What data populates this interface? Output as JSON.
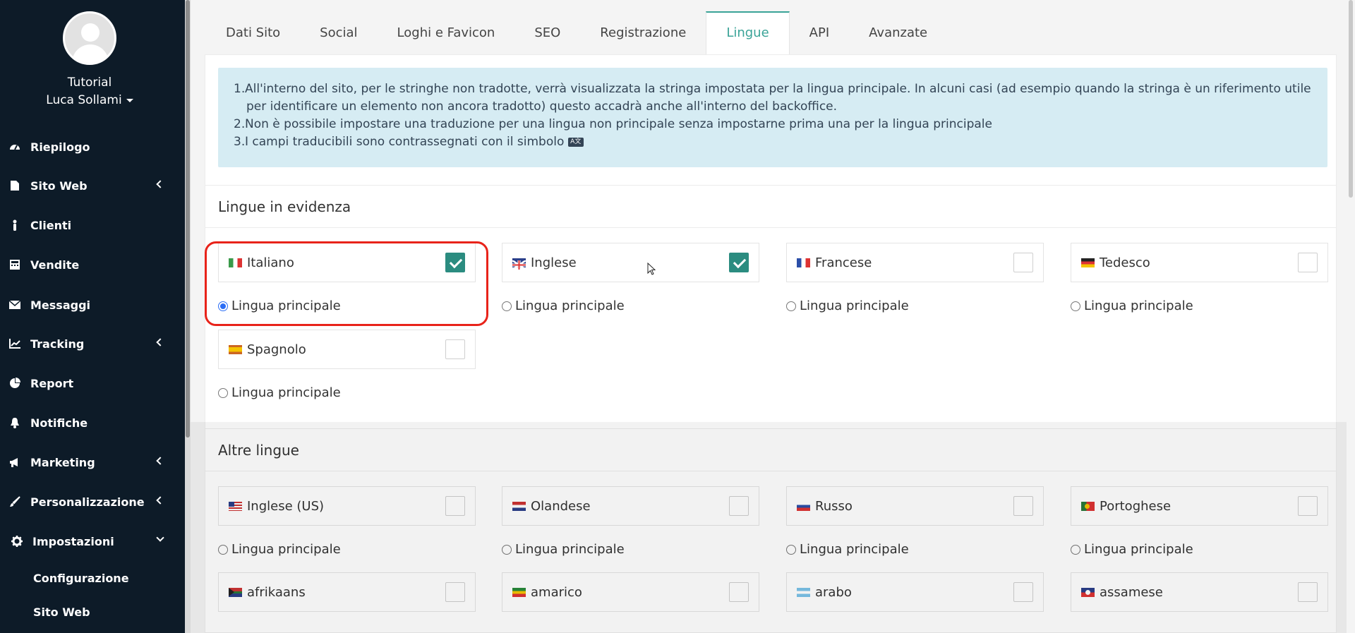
{
  "sidebar": {
    "user_title": "Tutorial",
    "user_name": "Luca Sollami",
    "items": [
      {
        "label": "Riepilogo",
        "icon": "dashboard-icon"
      },
      {
        "label": "Sito Web",
        "icon": "file-icon"
      },
      {
        "label": "Clienti",
        "icon": "person-icon"
      },
      {
        "label": "Vendite",
        "icon": "cash-register-icon"
      },
      {
        "label": "Messaggi",
        "icon": "envelope-icon"
      },
      {
        "label": "Tracking",
        "icon": "chart-line-icon"
      },
      {
        "label": "Report",
        "icon": "pie-chart-icon"
      },
      {
        "label": "Notifiche",
        "icon": "bell-icon"
      },
      {
        "label": "Marketing",
        "icon": "megaphone-icon"
      },
      {
        "label": "Personalizzazione",
        "icon": "brush-icon"
      },
      {
        "label": "Impostazioni",
        "icon": "gear-icon"
      }
    ],
    "subitems": [
      {
        "label": "Configurazione"
      },
      {
        "label": "Sito Web"
      }
    ]
  },
  "tabs": [
    {
      "label": "Dati Sito"
    },
    {
      "label": "Social"
    },
    {
      "label": "Loghi e Favicon"
    },
    {
      "label": "SEO"
    },
    {
      "label": "Registrazione"
    },
    {
      "label": "Lingue",
      "active": true
    },
    {
      "label": "API"
    },
    {
      "label": "Avanzate"
    }
  ],
  "info": {
    "items": [
      {
        "num": "1.",
        "text": "All'interno del sito, per le stringhe non tradotte, verrà visualizzata la stringa impostata per la lingua principale. In alcuni casi (ad esempio quando la stringa è un riferimento utile per identificare un elemento non ancora tradotto) questo accadrà anche all'interno del backoffice."
      },
      {
        "num": "2.",
        "text": "Non è possibile impostare una traduzione per una lingua non principale senza impostarne prima una per la lingua principale"
      },
      {
        "num": "3.",
        "text": "I campi traducibili sono contrassegnati con il simbolo"
      }
    ]
  },
  "featured": {
    "title": "Lingue in evidenza",
    "radio_label": "Lingua principale",
    "languages": [
      {
        "name": "Italiano",
        "flag": "italy-flag-icon",
        "checked": true,
        "main": true
      },
      {
        "name": "Inglese",
        "flag": "uk-flag-icon",
        "checked": true,
        "main": false
      },
      {
        "name": "Francese",
        "flag": "france-flag-icon",
        "checked": false,
        "main": false
      },
      {
        "name": "Tedesco",
        "flag": "germany-flag-icon",
        "checked": false,
        "main": false
      },
      {
        "name": "Spagnolo",
        "flag": "spain-flag-icon",
        "checked": false,
        "main": false
      }
    ]
  },
  "other": {
    "title": "Altre lingue",
    "radio_label": "Lingua principale",
    "languages": [
      {
        "name": "Inglese (US)",
        "flag": "us-flag-icon"
      },
      {
        "name": "Olandese",
        "flag": "netherlands-flag-icon"
      },
      {
        "name": "Russo",
        "flag": "russia-flag-icon"
      },
      {
        "name": "Portoghese",
        "flag": "portugal-flag-icon"
      },
      {
        "name": "afrikaans",
        "flag": "south-africa-flag-icon"
      },
      {
        "name": "amarico",
        "flag": "ethiopia-flag-icon"
      },
      {
        "name": "arabo",
        "flag": "argentina-flag-icon"
      },
      {
        "name": "assamese",
        "flag": "assam-flag-icon"
      }
    ]
  },
  "colors": {
    "sidebar_bg": "#0d1b28",
    "accent": "#3aa397",
    "checkbox_checked": "#2b8c80",
    "info_bg": "#d6ecf3",
    "highlight": "#e8231a"
  }
}
